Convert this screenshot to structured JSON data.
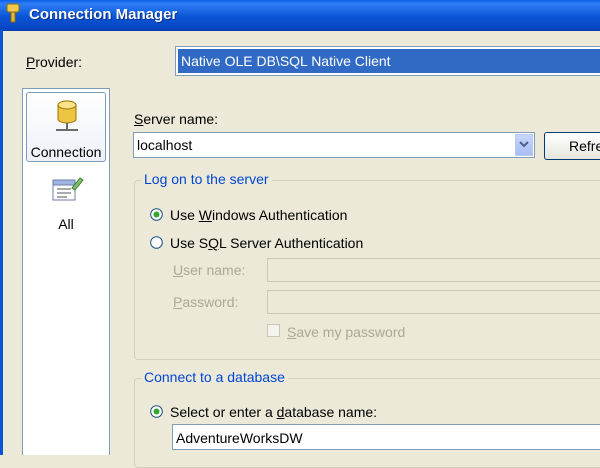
{
  "window": {
    "title": "Connection Manager"
  },
  "provider": {
    "label_pre": "",
    "label_accel": "P",
    "label_post": "rovider:",
    "value": "Native OLE DB\\SQL Native Client"
  },
  "nav": {
    "items": [
      {
        "label": "Connection",
        "icon": "database-icon",
        "active": true
      },
      {
        "label": "All",
        "icon": "properties-list-icon",
        "active": false
      }
    ]
  },
  "server": {
    "label_pre": "",
    "label_accel": "S",
    "label_post": "erver name:",
    "value": "localhost",
    "refresh_label": "Refresh"
  },
  "logon": {
    "title": "Log on to the server",
    "windows_auth": {
      "pre": "Use ",
      "accel": "W",
      "post": "indows Authentication",
      "selected": true
    },
    "sql_auth": {
      "pre": "Use S",
      "accel": "Q",
      "post": "L Server Authentication",
      "selected": false
    },
    "username": {
      "pre": "",
      "accel": "U",
      "post": "ser name:"
    },
    "password": {
      "pre": "",
      "accel": "P",
      "post": "assword:"
    },
    "save_password": {
      "pre": "",
      "accel": "S",
      "post": "ave my password",
      "checked": false
    }
  },
  "database": {
    "title": "Connect to a database",
    "select_option": {
      "pre": "Select or enter a ",
      "accel": "d",
      "post": "atabase name:",
      "selected": true
    },
    "value": "AdventureWorksDW"
  },
  "colors": {
    "title_bar": "#0a55d6",
    "selection": "#316ac5",
    "group_title": "#0046d5",
    "window_bg": "#ece9d8"
  }
}
